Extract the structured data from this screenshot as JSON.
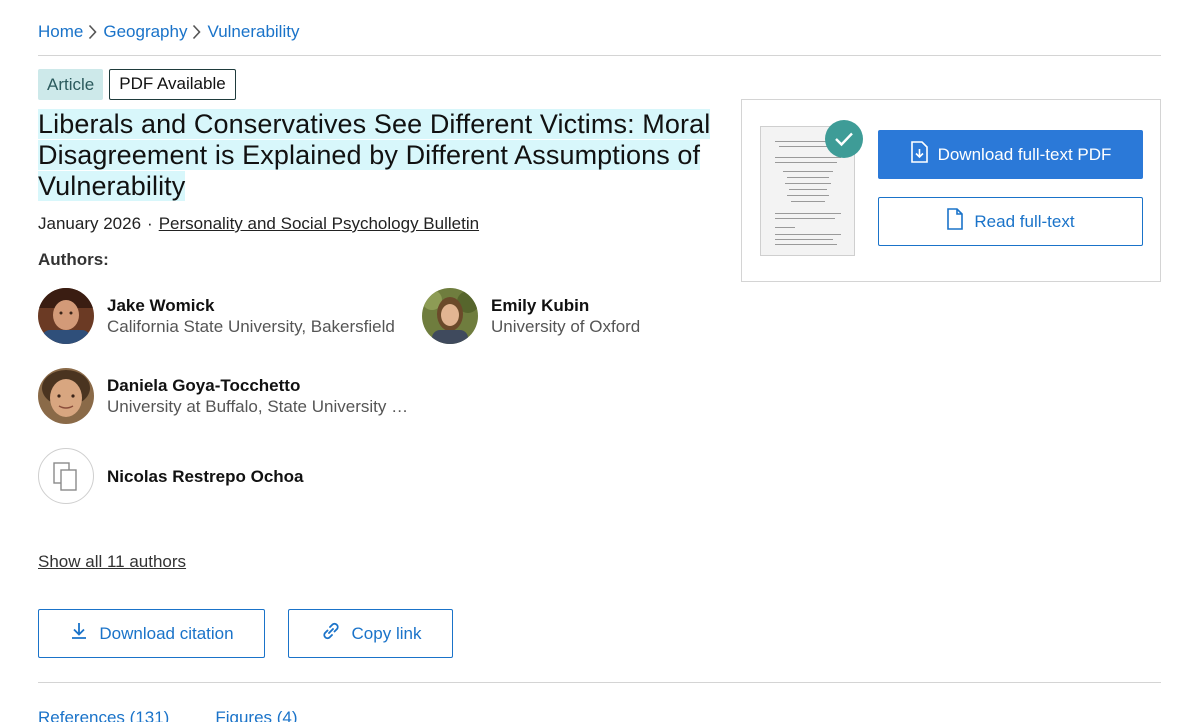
{
  "breadcrumb": {
    "items": [
      "Home",
      "Geography",
      "Vulnerability"
    ]
  },
  "badges": {
    "type": "Article",
    "availability": "PDF Available"
  },
  "article": {
    "title": "Liberals and Conservatives See Different Victims: Moral Disagreement is Explained by Different Assumptions of Vulnerability",
    "date": "January 2026",
    "separator": "·",
    "journal": "Personality and Social Psychology Bulletin"
  },
  "authors": {
    "label": "Authors:",
    "list": [
      {
        "name": "Jake Womick",
        "affiliation": "California State University, Bakersfield",
        "avatar": "photo"
      },
      {
        "name": "Emily Kubin",
        "affiliation": "University of Oxford",
        "avatar": "photo"
      },
      {
        "name": "Daniela Goya-Tocchetto",
        "affiliation": "University at Buffalo, State University of New York",
        "avatar": "photo"
      },
      {
        "name": "Nicolas Restrepo Ochoa",
        "affiliation": "",
        "avatar": "placeholder-icon"
      }
    ],
    "show_all": "Show all 11 authors"
  },
  "actions": {
    "download_citation": "Download citation",
    "copy_link": "Copy link"
  },
  "tabs": {
    "references": "References (131)",
    "figures": "Figures (4)"
  },
  "pdf_card": {
    "download_label": "Download full-text PDF",
    "read_label": "Read full-text"
  },
  "colors": {
    "accent": "#1a73c9",
    "primary_button": "#2b79d8",
    "badge_bg": "#cde9ea",
    "title_highlight": "#d8f7fb",
    "check_badge": "#3e9c97"
  }
}
